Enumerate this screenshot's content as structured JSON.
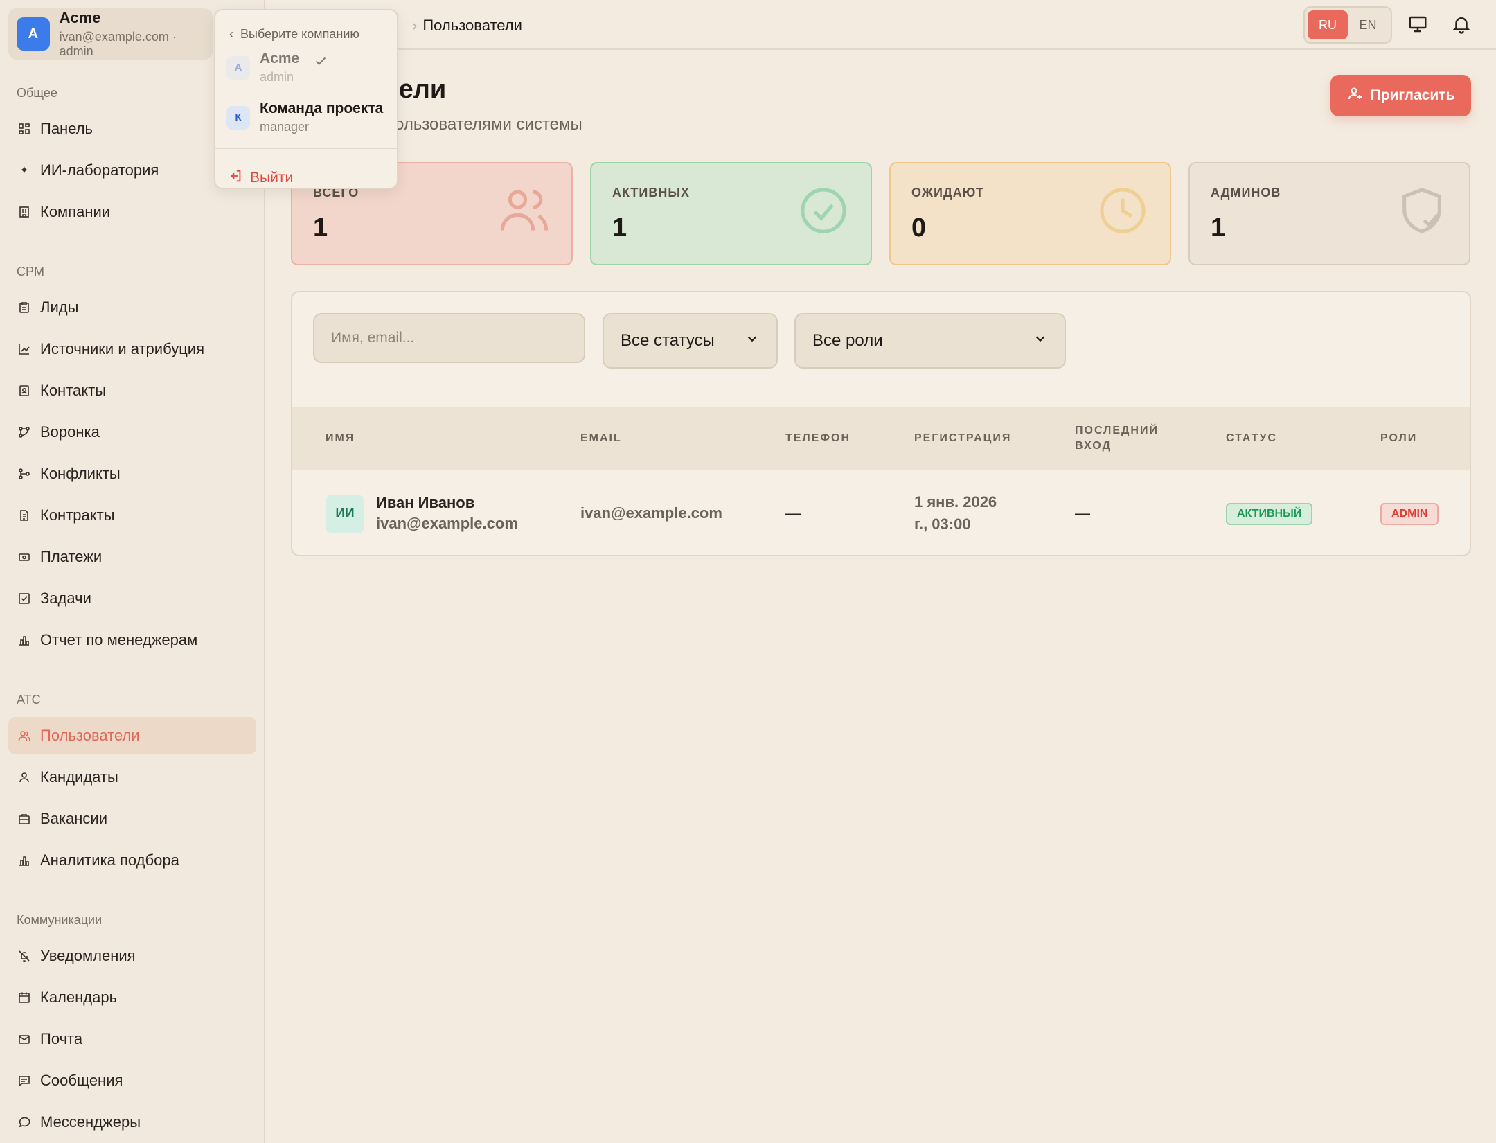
{
  "company_switch": {
    "avatar": "A",
    "name": "Acme",
    "subtitle": "ivan@example.com · admin"
  },
  "sidebar": {
    "sections": [
      {
        "title": "Общее"
      },
      {
        "title": "CPM"
      },
      {
        "title": "ATC"
      },
      {
        "title": "Коммуникации"
      }
    ],
    "items": [
      {
        "label": "Панель",
        "icon": "dashboard-icon"
      },
      {
        "label": "ИИ-лаборатория",
        "icon": "sparkles-icon"
      },
      {
        "label": "Компании",
        "icon": "building-icon"
      },
      {
        "label": "Лиды",
        "icon": "clipboard-icon"
      },
      {
        "label": "Источники и атрибуция",
        "icon": "chart-line-icon"
      },
      {
        "label": "Контакты",
        "icon": "contact-icon"
      },
      {
        "label": "Воронка",
        "icon": "funnel-icon"
      },
      {
        "label": "Конфликты",
        "icon": "git-branch-icon"
      },
      {
        "label": "Контракты",
        "icon": "document-icon"
      },
      {
        "label": "Платежи",
        "icon": "banknote-icon"
      },
      {
        "label": "Задачи",
        "icon": "checkbox-icon"
      },
      {
        "label": "Отчет по менеджерам",
        "icon": "bar-chart-icon"
      },
      {
        "label": "Пользователи",
        "icon": "users-icon",
        "active": true
      },
      {
        "label": "Кандидаты",
        "icon": "user-icon"
      },
      {
        "label": "Вакансии",
        "icon": "briefcase-icon"
      },
      {
        "label": "Аналитика подбора",
        "icon": "bar-chart-icon"
      },
      {
        "label": "Уведомления",
        "icon": "bell-off-icon"
      },
      {
        "label": "Календарь",
        "icon": "calendar-icon"
      },
      {
        "label": "Почта",
        "icon": "mail-icon"
      },
      {
        "label": "Сообщения",
        "icon": "message-square-icon"
      },
      {
        "label": "Мессенджеры",
        "icon": "message-circle-icon"
      }
    ]
  },
  "dropdown": {
    "header": "Выберите компанию",
    "companies": [
      {
        "avatar": "A",
        "name": "Acme",
        "role": "admin",
        "selected": true
      },
      {
        "avatar": "К",
        "name": "Команда проекта",
        "role": "manager",
        "selected": false
      }
    ],
    "logout": "Выйти"
  },
  "topbar": {
    "breadcrumb": "Пользователи",
    "languages": [
      "RU",
      "EN"
    ],
    "active_language": "RU"
  },
  "page": {
    "title": "Пользователи",
    "title_visible": "тели",
    "subtitle": "Управление пользователями системы",
    "subtitle_visible": "пользователями системы",
    "invite_label": "Пригласить"
  },
  "stats": [
    {
      "label": "ВСЕГО",
      "value": "1",
      "icon": "users-icon",
      "color": "#f2d6cb"
    },
    {
      "label": "АКТИВНЫХ",
      "value": "1",
      "icon": "check-circle-icon",
      "color": "#d9e8d5"
    },
    {
      "label": "ОЖИДАЮТ",
      "value": "0",
      "icon": "clock-icon",
      "color": "#f3e1c8"
    },
    {
      "label": "АДМИНОВ",
      "value": "1",
      "icon": "shield-check-icon",
      "color": "#ede3d7"
    }
  ],
  "filters": {
    "search_placeholder": "Имя, email...",
    "status_value": "Все статусы",
    "role_value": "Все роли"
  },
  "table": {
    "columns": [
      "ИМЯ",
      "EMAIL",
      "ТЕЛЕФОН",
      "РЕГИСТРАЦИЯ",
      "ПОСЛЕДНИЙ ВХОД",
      "СТАТУС",
      "РОЛИ"
    ],
    "rows": [
      {
        "initials": "ИИ",
        "name": "Иван Иванов",
        "sub_email": "ivan@example.com",
        "email": "ivan@example.com",
        "phone": "—",
        "registered_line1": "1 янв. 2026",
        "registered_line2": "г., 03:00",
        "last_login": "—",
        "status": "АКТИВНЫЙ",
        "role": "ADMIN"
      }
    ]
  }
}
